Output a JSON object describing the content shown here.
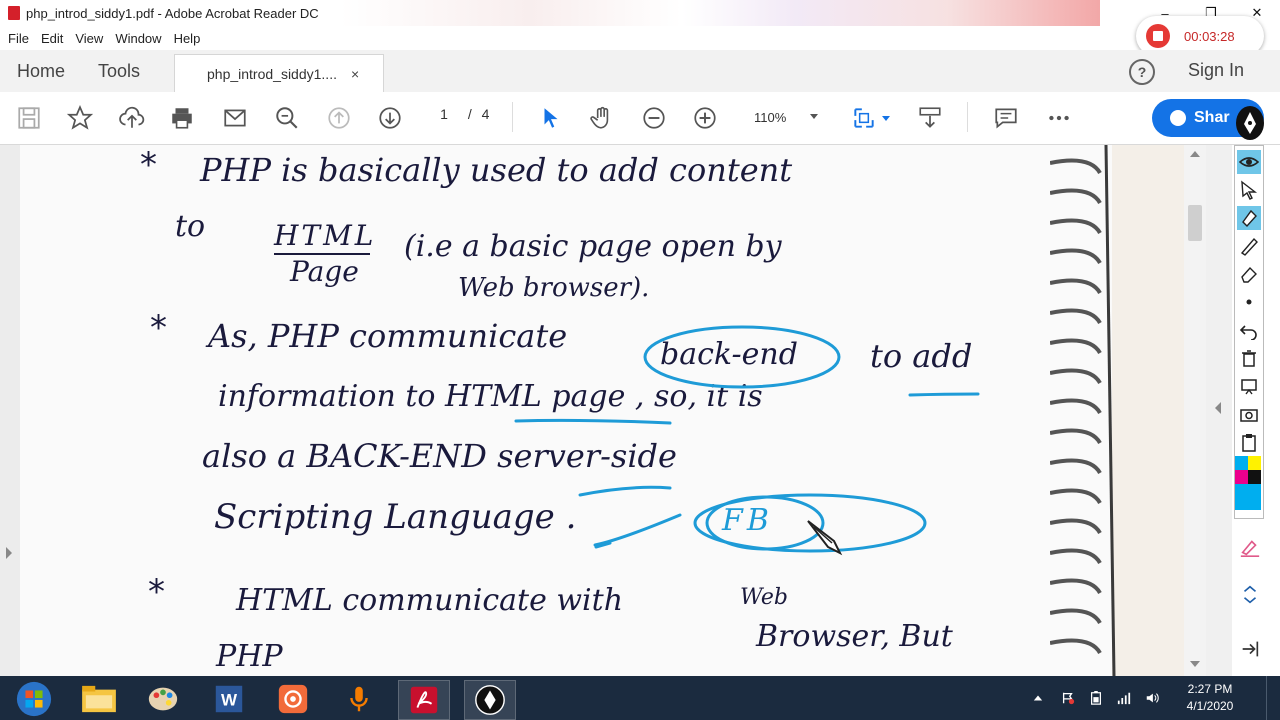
{
  "window": {
    "title": "php_introd_siddy1.pdf - Adobe Acrobat Reader DC",
    "controls": [
      "–",
      "❐",
      "✕"
    ]
  },
  "menu": [
    "File",
    "Edit",
    "View",
    "Window",
    "Help"
  ],
  "recorder": {
    "time": "00:03:28"
  },
  "tabs": {
    "home": "Home",
    "tools": "Tools",
    "document": "php_introd_siddy1....",
    "close": "×"
  },
  "header": {
    "help": "?",
    "signin": "Sign In"
  },
  "toolbar": {
    "page_current": "1",
    "page_separator": "/",
    "page_total": "4",
    "zoom": "110%",
    "share_label": "Shar"
  },
  "note_lines": [
    {
      "text": "PHP   is   basically   used  to  add  content"
    },
    {
      "text": "to"
    },
    {
      "text": "HTML"
    },
    {
      "text": "Page"
    },
    {
      "text": "(i.e  a basic  page  open  by"
    },
    {
      "text": "Web  browser)."
    },
    {
      "text": "As,  PHP    communicate"
    },
    {
      "text": "back-end"
    },
    {
      "text": "to  add"
    },
    {
      "text": "information   to  HTML  page  , so,  it  is"
    },
    {
      "text": "also    a    BACK-END   server-side"
    },
    {
      "text": "Scripting   Language ."
    },
    {
      "text": "FB"
    },
    {
      "text": "HTML    communicate   with"
    },
    {
      "text": "Web"
    },
    {
      "text": "Browser,  But"
    },
    {
      "text": "PHP"
    }
  ],
  "bullets": [
    "*",
    "*",
    "*"
  ],
  "taskbar": {
    "time": "2:27 PM",
    "date": "4/1/2020"
  },
  "colors": {
    "accent": "#1473e6",
    "record": "#e53935",
    "annotation": "#1e9bd7",
    "taskbar": "#1b2b3f"
  }
}
